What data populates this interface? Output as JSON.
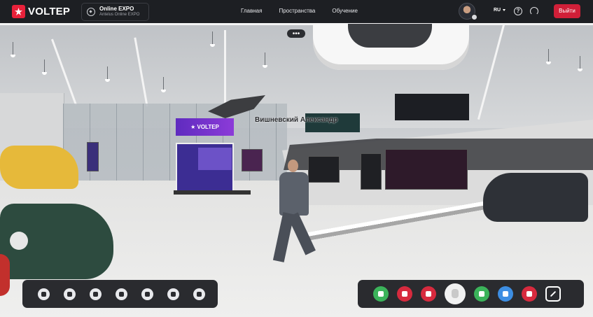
{
  "header": {
    "brand": "VOLTEP",
    "event": {
      "title": "Online EXPO",
      "subtitle": "Antelus Online EXPO"
    },
    "nav": [
      "Главная",
      "Пространства",
      "Обучение"
    ],
    "language": "RU",
    "logout_label": "Выйти"
  },
  "scene": {
    "player_name": "Вишневский Александр",
    "booth_brand": "VOLTEP",
    "menu_label": "•••"
  },
  "toolbar_left": {
    "icons": [
      "gear-icon",
      "volume-icon",
      "map-icon",
      "smile-icon",
      "camera-rotate-icon",
      "hand-pointer-icon",
      "brightness-icon"
    ]
  },
  "toolbar_right": {
    "buttons": [
      {
        "icon": "microphone-icon",
        "color": "#3bb35a"
      },
      {
        "icon": "video-off-icon",
        "color": "#d72a3e"
      },
      {
        "icon": "screen-share-off-icon",
        "color": "#d72a3e"
      },
      {
        "icon": "raise-hand-icon",
        "color": "#f1f1f1"
      },
      {
        "icon": "headphones-icon",
        "color": "#3bb35a"
      },
      {
        "icon": "telegram-icon",
        "color": "#3d8ee3"
      },
      {
        "icon": "exit-icon",
        "color": "#d72a3e"
      },
      {
        "icon": "fullscreen-icon",
        "color": "transparent"
      }
    ]
  },
  "colors": {
    "accent": "#d01f38",
    "header_bg": "#1d1f23",
    "toolbar_bg": "#2a2b2f"
  }
}
